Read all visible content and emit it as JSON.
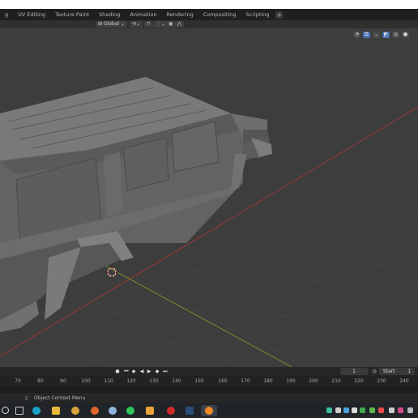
{
  "workspace_tabs": [
    {
      "label": "g"
    },
    {
      "label": "UV Editing"
    },
    {
      "label": "Texture Paint"
    },
    {
      "label": "Shading"
    },
    {
      "label": "Animation"
    },
    {
      "label": "Rendering"
    },
    {
      "label": "Compositing"
    },
    {
      "label": "Scripting"
    }
  ],
  "workspace_add": "+",
  "header": {
    "transform_orientation": "Global"
  },
  "playback": {
    "current_frame": "1",
    "start_label": "Start",
    "start_value": "1"
  },
  "timeline_ticks": [
    "70",
    "80",
    "90",
    "100",
    "110",
    "120",
    "130",
    "140",
    "150",
    "160",
    "170",
    "180",
    "190",
    "200",
    "210",
    "220",
    "230",
    "240"
  ],
  "status": {
    "context_menu_label": "Object Context Menu"
  },
  "colors": {
    "x_axis": "#a33636",
    "y_axis": "#7a9a2a",
    "viewport_bg": "#3d3d3d",
    "active_blue": "#4772b3"
  },
  "icons": [
    "pan-icon",
    "view-icon",
    "overlay-icon",
    "shading-icon",
    "cursor-icon",
    "jump-start-icon",
    "prev-key-icon",
    "play-reverse-icon",
    "play-icon",
    "next-key-icon",
    "jump-end-icon",
    "stopwatch-icon"
  ]
}
